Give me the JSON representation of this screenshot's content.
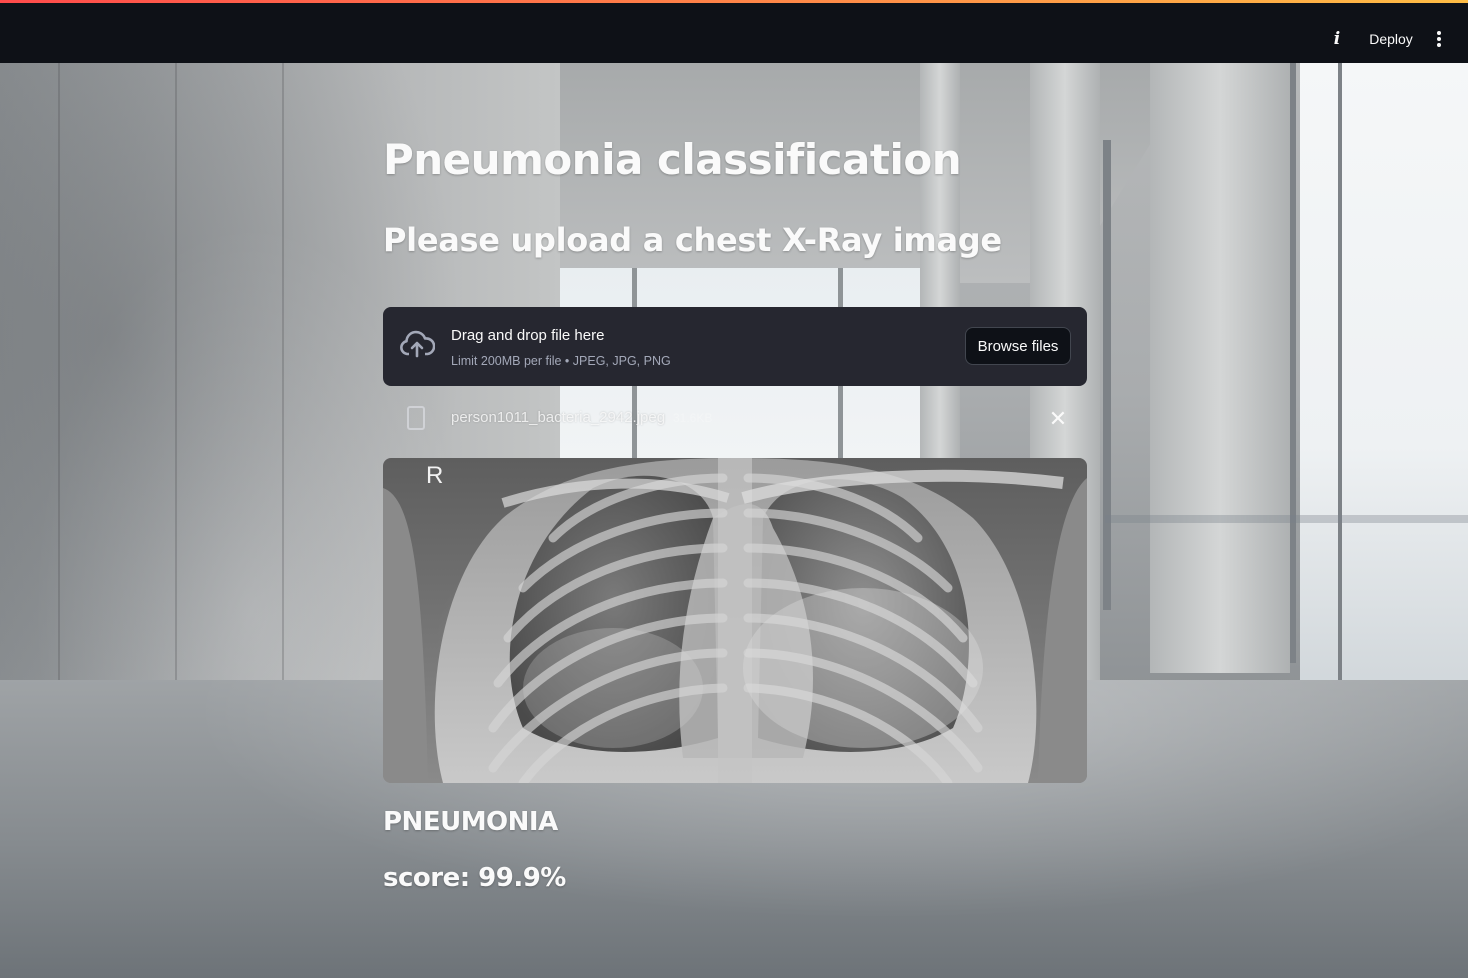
{
  "header": {
    "info_icon": "info-icon",
    "deploy_label": "Deploy",
    "menu_icon": "more-vertical-icon"
  },
  "main": {
    "title": "Pneumonia classification",
    "subtitle": "Please upload a chest X-Ray image",
    "uploader": {
      "icon": "cloud-upload-icon",
      "title": "Drag and drop file here",
      "limit": "Limit 200MB per file • JPEG, JPG, PNG",
      "browse_label": "Browse files"
    },
    "uploaded_file": {
      "icon": "file-icon",
      "name": "person1011_bacteria_2942.jpeg",
      "size": "31.6KB",
      "remove_icon": "close-icon"
    },
    "image": {
      "marker": "R"
    },
    "result": {
      "label": "PNEUMONIA",
      "score": "score: 99.9%"
    }
  },
  "colors": {
    "header_bg": "#0e1117",
    "dropzone_bg": "#262730",
    "accent_gradient_start": "#ff4b4b",
    "accent_gradient_end": "#ffbd45",
    "text": "#fafafa"
  }
}
